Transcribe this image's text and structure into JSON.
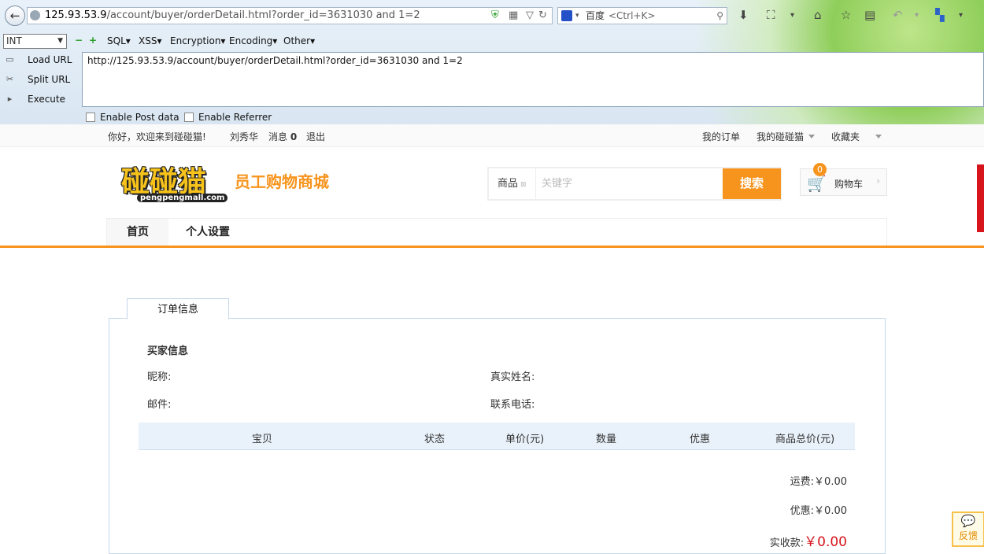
{
  "browser": {
    "url_host": "125.93.53.9",
    "url_path": "/account/buyer/orderDetail.html?order_id=3631030 and 1=2",
    "search_engine": "百度",
    "search_placeholder": "<Ctrl+K>"
  },
  "hackbar": {
    "type_select": "INT",
    "menus": [
      "SQL",
      "XSS",
      "Encryption",
      "Encoding",
      "Other"
    ],
    "load_url": "Load URL",
    "split_url": "Split URL",
    "execute": "Execute",
    "url_text": "http://125.93.53.9/account/buyer/orderDetail.html?order_id=3631030 and 1=2",
    "enable_post": "Enable Post data",
    "enable_referrer": "Enable Referrer"
  },
  "topbar": {
    "welcome": "你好，欢迎来到碰碰猫!",
    "user": "刘秀华",
    "messages": "消息",
    "message_count": "0",
    "logout": "退出",
    "my_orders": "我的订单",
    "my_site": "我的碰碰猫",
    "favorites": "收藏夹"
  },
  "header": {
    "logo_main": "碰碰猫",
    "logo_tag": "员工购物商城",
    "logo_domain": "pengpengmall.com",
    "search_category": "商品",
    "search_placeholder": "关键字",
    "search_button": "搜索",
    "cart_count": "0",
    "cart_label": "购物车"
  },
  "nav": {
    "home": "首页",
    "settings": "个人设置"
  },
  "order": {
    "tab": "订单信息",
    "buyer_section": "买家信息",
    "nickname_label": "昵称:",
    "realname_label": "真实姓名:",
    "email_label": "邮件:",
    "phone_label": "联系电话:",
    "columns": [
      "宝贝",
      "状态",
      "单价(元)",
      "数量",
      "优惠",
      "商品总价(元)"
    ],
    "shipping_label": "运费:",
    "shipping_value": "￥0.00",
    "discount_label": "优惠:",
    "discount_value": "￥0.00",
    "paid_label": "实收款:",
    "paid_value": "￥0.00"
  },
  "feedback": "反馈",
  "colors": {
    "accent": "#f7941d",
    "price_red": "#d7141c"
  }
}
